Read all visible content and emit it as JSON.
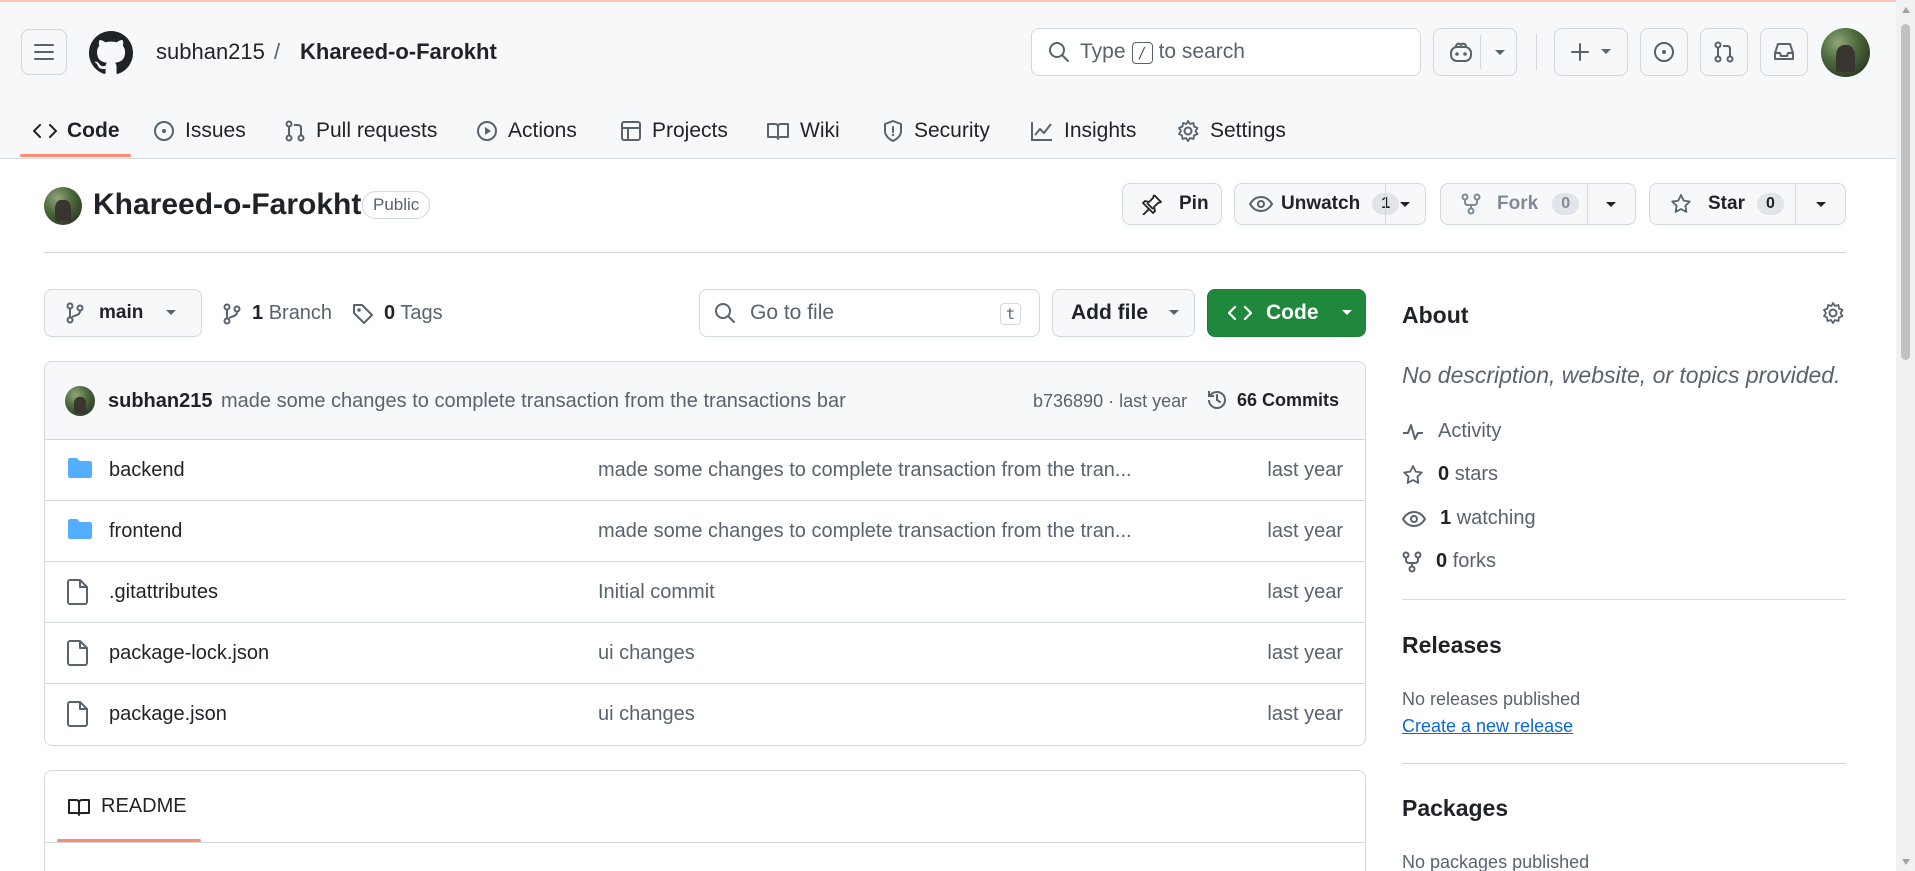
{
  "header": {
    "owner": "subhan215",
    "slash": "/",
    "repo": "Khareed-o-Farokht",
    "search_prefix": "Type",
    "search_key": "/",
    "search_suffix": "to search"
  },
  "tabs": [
    {
      "label": "Code",
      "icon": "code-icon"
    },
    {
      "label": "Issues",
      "icon": "issue-icon"
    },
    {
      "label": "Pull requests",
      "icon": "pull-request-icon"
    },
    {
      "label": "Actions",
      "icon": "play-icon"
    },
    {
      "label": "Projects",
      "icon": "table-icon"
    },
    {
      "label": "Wiki",
      "icon": "book-icon"
    },
    {
      "label": "Security",
      "icon": "shield-icon"
    },
    {
      "label": "Insights",
      "icon": "graph-icon"
    },
    {
      "label": "Settings",
      "icon": "gear-icon"
    }
  ],
  "repo": {
    "title": "Khareed-o-Farokht",
    "visibility": "Public",
    "pin_label": "Pin",
    "unwatch_label": "Unwatch",
    "watch_count": "1",
    "fork_label": "Fork",
    "fork_count": "0",
    "star_label": "Star",
    "star_count": "0"
  },
  "toolbar": {
    "branch": "main",
    "branch_count": "1",
    "branch_label": "Branch",
    "tag_count": "0",
    "tag_label": "Tags",
    "goto_placeholder": "Go to file",
    "goto_key": "t",
    "add_file": "Add file",
    "code": "Code"
  },
  "commit": {
    "author": "subhan215",
    "message": "made some changes to complete transaction from the transactions bar",
    "hash_time": "b736890 · last year",
    "commits_count": "66",
    "commits_label": "Commits"
  },
  "files": [
    {
      "name": "backend",
      "type": "folder",
      "message": "made some changes to complete transaction from the tran...",
      "time": "last year"
    },
    {
      "name": "frontend",
      "type": "folder",
      "message": "made some changes to complete transaction from the tran...",
      "time": "last year"
    },
    {
      "name": ".gitattributes",
      "type": "file",
      "message": "Initial commit",
      "time": "last year"
    },
    {
      "name": "package-lock.json",
      "type": "file",
      "message": "ui changes",
      "time": "last year"
    },
    {
      "name": "package.json",
      "type": "file",
      "message": "ui changes",
      "time": "last year"
    }
  ],
  "readme": {
    "label": "README"
  },
  "about": {
    "title": "About",
    "description": "No description, website, or topics provided.",
    "activity": "Activity",
    "stars_count": "0",
    "stars_label": "stars",
    "watching_count": "1",
    "watching_label": "watching",
    "forks_count": "0",
    "forks_label": "forks"
  },
  "releases": {
    "title": "Releases",
    "empty": "No releases published",
    "create_link": "Create a new release"
  },
  "packages": {
    "title": "Packages",
    "empty": "No packages published"
  },
  "colors": {
    "accent": "#fd8c73",
    "code_button": "#1f883d",
    "folder": "#54aeff",
    "link": "#0969da"
  }
}
